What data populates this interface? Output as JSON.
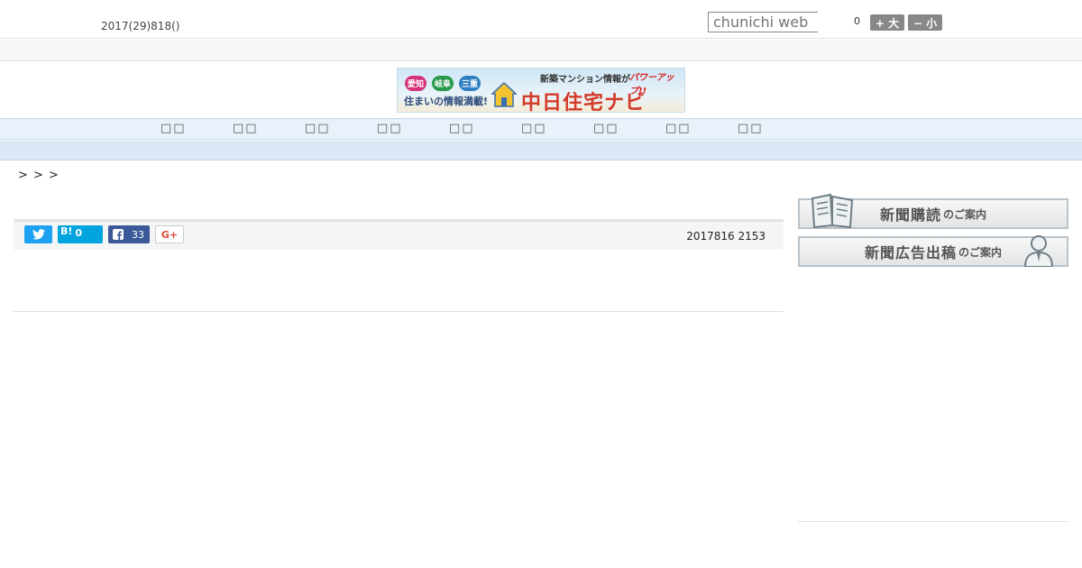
{
  "header": {
    "date": "2017(29)818()",
    "search_placeholder": "chunichi web",
    "count": "0",
    "font_large": "+ 大",
    "font_small": "− 小"
  },
  "banner": {
    "badge1": "愛知",
    "badge2": "岐阜",
    "badge3": "三重",
    "subtitle": "住まいの情報満載!",
    "top_text": "新築マンション情報が",
    "up_text": "パワーアップ!!",
    "main_text": "中日住宅ナビ"
  },
  "nav": {
    "items": [
      "□□",
      "□□",
      "□□",
      "□□",
      "□□",
      "□□",
      "□□",
      "□□",
      "□□"
    ]
  },
  "breadcrumb": "> > >",
  "social": {
    "twitter_icon": "twitter-icon",
    "hatena_label": "B!",
    "hatena_count": "0",
    "facebook_count": "33",
    "gplus_label": "G+",
    "timestamp": "2017816 2153"
  },
  "sidebar": {
    "subscribe_main": "新聞購読",
    "subscribe_suffix": "のご案内",
    "advert_main": "新聞広告出稿",
    "advert_suffix": "のご案内"
  },
  "colors": {
    "twitter": "#1da1f2",
    "hatena": "#00a4de",
    "facebook": "#3b5998",
    "gplus": "#dd4b39",
    "nav_bg": "#e9f1fa"
  }
}
